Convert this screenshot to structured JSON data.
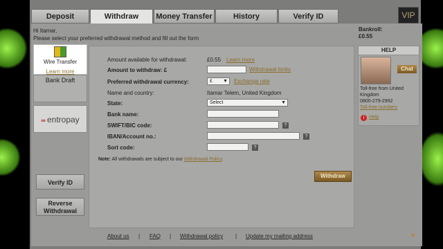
{
  "tabs": [
    {
      "label": "Deposit"
    },
    {
      "label": "Withdraw",
      "active": true
    },
    {
      "label": "Money Transfer"
    },
    {
      "label": "History"
    },
    {
      "label": "Verify ID"
    }
  ],
  "vip_label": "VIP",
  "greeting": {
    "line1": "Hi Itamar,",
    "line2": "Please select your preferred withdrawal method and fill out the form"
  },
  "bankroll": {
    "label": "Bankroll:",
    "value": "£0.55"
  },
  "methods": [
    {
      "label": "Wire Transfer",
      "link": "Learn more",
      "active": true,
      "icon": "wire-transfer-icon"
    },
    {
      "label": "Bank Draft"
    },
    {
      "label": "entropay",
      "icon": "entropay-logo"
    }
  ],
  "side_buttons": {
    "verify": "Verify ID",
    "reverse": "Reverse Withdrawal"
  },
  "form": {
    "available_label": "Amount available for withdrawal:",
    "available_value": "£0.55",
    "available_link": "Learn more",
    "amount_label": "Amount to withdraw: £",
    "amount_link": "Withdrawal limits",
    "currency_label": "Preferred withdrawal currency:",
    "currency_value": "£",
    "currency_link": "Exchange rate",
    "name_label": "Name and country:",
    "name_value": "Itamar Telem, United Kingdom",
    "state_label": "State:",
    "state_value": "Select",
    "bank_label": "Bank name:",
    "swift_label": "SWIFT/BIC code:",
    "iban_label": "IBAN/Account no.:",
    "sort_label": "Sort code:",
    "note_bold": "Note:",
    "note_text": "All withdrawals are subject to our",
    "note_link": "Withdrawal Policy",
    "withdraw_button": "Withdraw"
  },
  "help": {
    "title": "HELP",
    "chat": "Chat",
    "tollfree": "Toll-free from United Kingdom",
    "phone": "0800-279-2992",
    "numbers_link": "Toll-free numbers",
    "help_link": "Help"
  },
  "footer": [
    "About us",
    "FAQ",
    "Withdrawal policy",
    "Update my mailing address"
  ],
  "colors": {
    "accent": "#8a6d2c",
    "button": "#7a5a24",
    "glow": "#7fd64a"
  }
}
